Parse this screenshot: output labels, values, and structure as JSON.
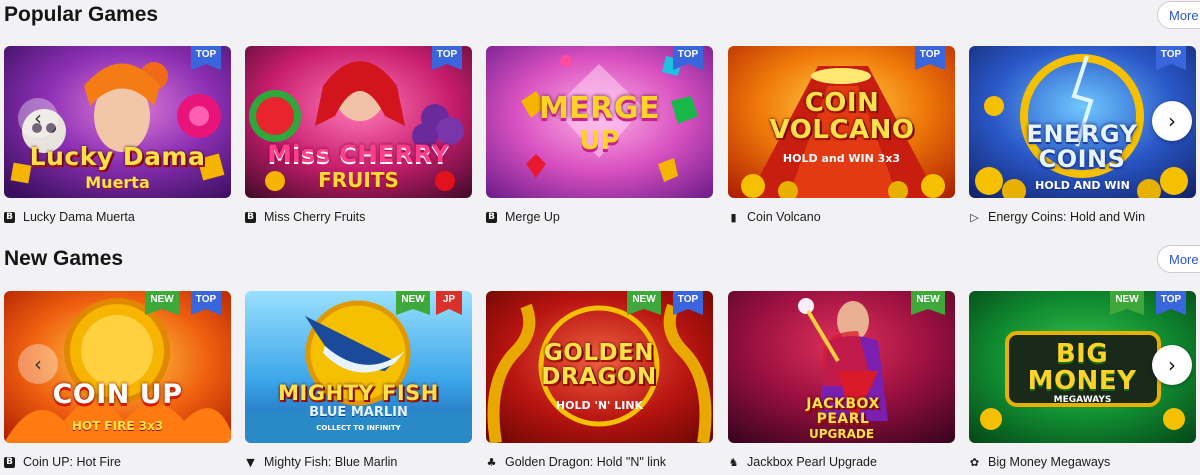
{
  "sections": [
    {
      "title": "Popular Games",
      "more_label": "More",
      "games": [
        {
          "name": "Lucky Dama Muerta",
          "art_title": "Lucky Dama",
          "art_sub": "Muerta",
          "badges": [
            "TOP"
          ],
          "provider_icon": "B"
        },
        {
          "name": "Miss Cherry Fruits",
          "art_title": "Miss CHERRY",
          "art_sub": "FRUITS",
          "badges": [
            "TOP"
          ],
          "provider_icon": "B"
        },
        {
          "name": "Merge Up",
          "art_title": "MERGE",
          "art_sub": "UP",
          "badges": [
            "TOP"
          ],
          "provider_icon": "B"
        },
        {
          "name": "Coin Volcano",
          "art_title": "COIN VOLCANO",
          "art_sub": "HOLD and WIN 3x3",
          "badges": [
            "TOP"
          ],
          "provider_icon": "▮"
        },
        {
          "name": "Energy Coins: Hold and Win",
          "art_title": "ENERGY COINS",
          "art_sub": "HOLD AND WIN",
          "badges": [
            "TOP"
          ],
          "provider_icon": "▷"
        }
      ]
    },
    {
      "title": "New Games",
      "more_label": "More",
      "games": [
        {
          "name": "Coin UP: Hot Fire",
          "art_title": "COIN UP",
          "art_sub": "HOT FIRE 3x3",
          "badges": [
            "NEW",
            "TOP"
          ],
          "provider_icon": "B"
        },
        {
          "name": "Mighty Fish: Blue Marlin",
          "art_title": "MIGHTY FISH",
          "art_sub": "BLUE MARLIN",
          "art_sub2": "COLLECT TO INFINITY",
          "badges": [
            "NEW",
            "JP"
          ],
          "provider_icon": "▼"
        },
        {
          "name": "Golden Dragon: Hold \"N\" link",
          "art_title": "GOLDEN DRAGON",
          "art_sub": "HOLD 'N' LINK",
          "badges": [
            "NEW",
            "TOP"
          ],
          "provider_icon": "♣"
        },
        {
          "name": "Jackbox Pearl Upgrade",
          "art_title": "JACKBOX PEARL",
          "art_sub": "UPGRADE",
          "badges": [
            "NEW"
          ],
          "provider_icon": "♞"
        },
        {
          "name": "Big Money Megaways",
          "art_title": "BIG MONEY",
          "art_sub": "MEGAWAYS",
          "badges": [
            "NEW",
            "TOP"
          ],
          "provider_icon": "✿"
        }
      ]
    }
  ],
  "icons": {
    "next_arrow": "›",
    "prev_arrow": "‹"
  },
  "colors": {
    "top_badge": "#3a66dd",
    "new_badge": "#3fa83a",
    "jp_badge": "#d8322a",
    "more_text": "#2d56c4"
  }
}
